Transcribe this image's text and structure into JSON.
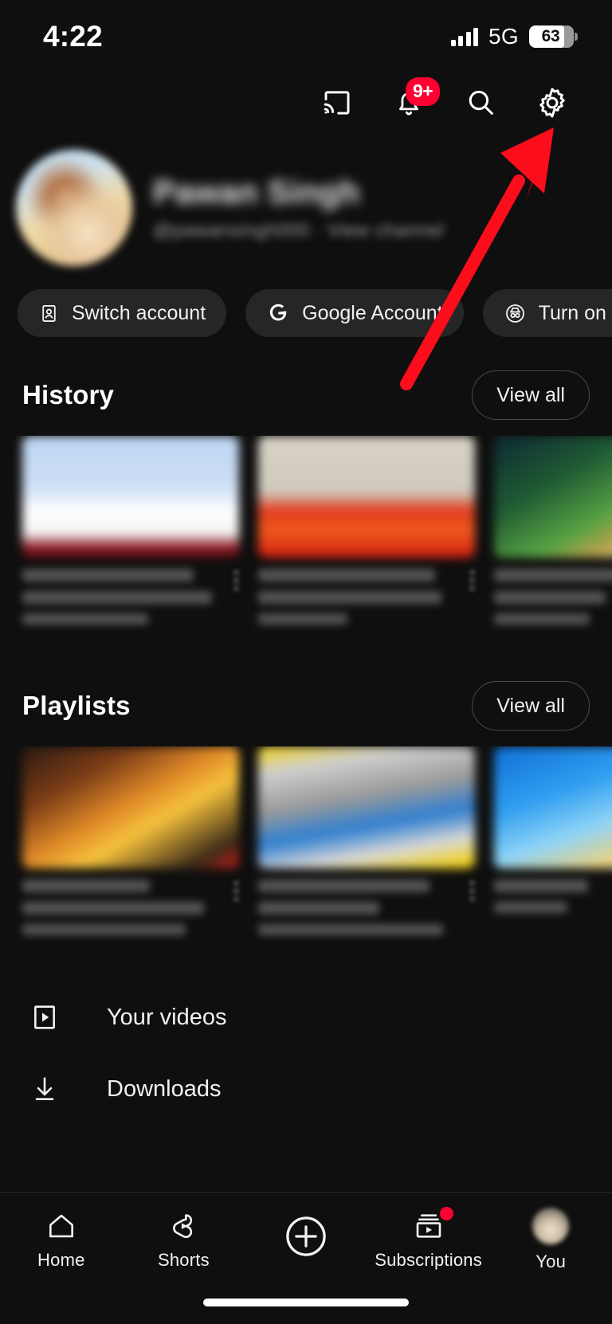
{
  "status_bar": {
    "time": "4:22",
    "network": "5G",
    "battery_percent": "63",
    "signal_icon": "signal-bars-icon",
    "battery_icon": "battery-icon"
  },
  "top_actions": [
    {
      "name": "cast-icon",
      "label": "Cast"
    },
    {
      "name": "notifications-bell-icon",
      "label": "Notifications",
      "badge": "9+"
    },
    {
      "name": "search-icon",
      "label": "Search"
    },
    {
      "name": "settings-gear-icon",
      "label": "Settings"
    }
  ],
  "profile": {
    "name": "Pawan Singh",
    "meta": "@pawansingh000  ·  View channel",
    "avatar_icon": "profile-avatar"
  },
  "chips": [
    {
      "label": "Switch account",
      "icon": "switch-account-icon"
    },
    {
      "label": "Google Account",
      "icon": "google-g-icon"
    },
    {
      "label": "Turn on Incognito",
      "icon": "incognito-hat-icon"
    }
  ],
  "history": {
    "title": "History",
    "view_all": "View all",
    "items": [
      {
        "title": "",
        "channel": "",
        "menu_icon": "more-vertical-icon"
      },
      {
        "title": "",
        "channel": "",
        "menu_icon": "more-vertical-icon"
      },
      {
        "title": "",
        "channel": "",
        "menu_icon": "more-vertical-icon"
      }
    ]
  },
  "playlists": {
    "title": "Playlists",
    "view_all": "View all",
    "items": [
      {
        "title": "",
        "meta": "",
        "menu_icon": "more-vertical-icon"
      },
      {
        "title": "",
        "meta": "",
        "menu_icon": "more-vertical-icon"
      },
      {
        "title": "",
        "meta": "",
        "menu_icon": "more-vertical-icon"
      }
    ]
  },
  "menu_rows": [
    {
      "label": "Your videos",
      "icon": "your-videos-icon"
    },
    {
      "label": "Downloads",
      "icon": "download-arrow-icon"
    }
  ],
  "bottom_nav": [
    {
      "label": "Home",
      "icon": "home-icon",
      "badge": false
    },
    {
      "label": "Shorts",
      "icon": "shorts-icon",
      "badge": false
    },
    {
      "label": "",
      "icon": "create-plus-icon",
      "badge": false
    },
    {
      "label": "Subscriptions",
      "icon": "subscriptions-icon",
      "badge": true
    },
    {
      "label": "You",
      "icon": "you-avatar-icon",
      "badge": false
    }
  ],
  "annotation": {
    "arrow_color": "#fc0d1b",
    "points_to": "settings-gear-icon"
  },
  "colors": {
    "background": "#0f0f0f",
    "chip_background": "#262626",
    "accent_red": "#ff0033",
    "text_primary": "#f1f1f1",
    "text_secondary": "#9a9a9a"
  }
}
